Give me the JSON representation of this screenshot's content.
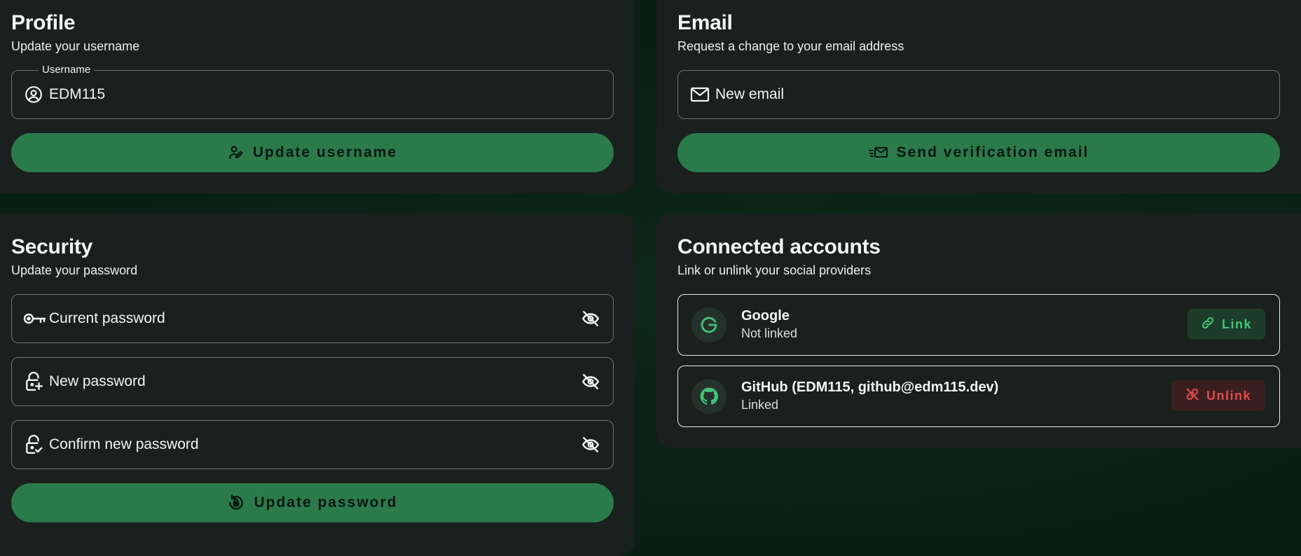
{
  "profile": {
    "title": "Profile",
    "subtitle": "Update your username",
    "username_label": "Username",
    "username_value": "EDM115",
    "update_button": "Update username"
  },
  "email": {
    "title": "Email",
    "subtitle": "Request a change to your email address",
    "new_email_placeholder": "New email",
    "send_button": "Send verification email"
  },
  "security": {
    "title": "Security",
    "subtitle": "Update your password",
    "current_password_placeholder": "Current password",
    "new_password_placeholder": "New password",
    "confirm_password_placeholder": "Confirm new password",
    "update_button": "Update password"
  },
  "connected": {
    "title": "Connected accounts",
    "subtitle": "Link or unlink your social providers",
    "accounts": [
      {
        "name": "Google",
        "status": "Not linked",
        "action": "Link",
        "icon": "google-icon"
      },
      {
        "name": "GitHub (EDM115, github@edm115.dev)",
        "status": "Linked",
        "action": "Unlink",
        "icon": "github-icon"
      }
    ]
  },
  "colors": {
    "primary_button": "#2b7a4a",
    "link_text": "#44c37a",
    "unlink_text": "#e04a4c",
    "card_background": "#1a201d"
  }
}
